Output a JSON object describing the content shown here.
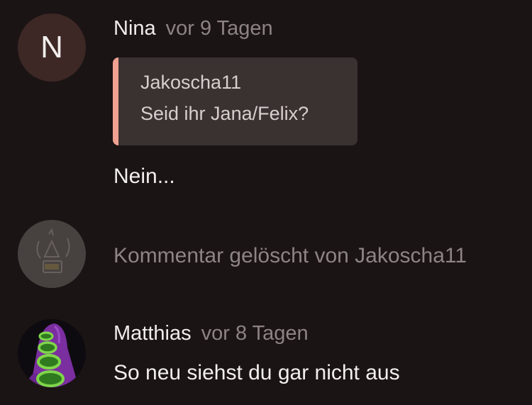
{
  "comments": [
    {
      "avatar_letter": "N",
      "author": "Nina",
      "time": "vor 9 Tagen",
      "quote": {
        "author": "Jakoscha11",
        "text": "Seid ihr Jana/Felix?"
      },
      "text": "Nein..."
    },
    {
      "deleted_text": "Kommentar gelöscht von Jakoscha11"
    },
    {
      "author": "Matthias",
      "time": "vor 8 Tagen",
      "text": "So neu siehst du gar nicht aus"
    }
  ],
  "colors": {
    "background": "#1b1414",
    "quote_accent": "#f1a192",
    "avatar_letter_bg": "#3d2825"
  }
}
